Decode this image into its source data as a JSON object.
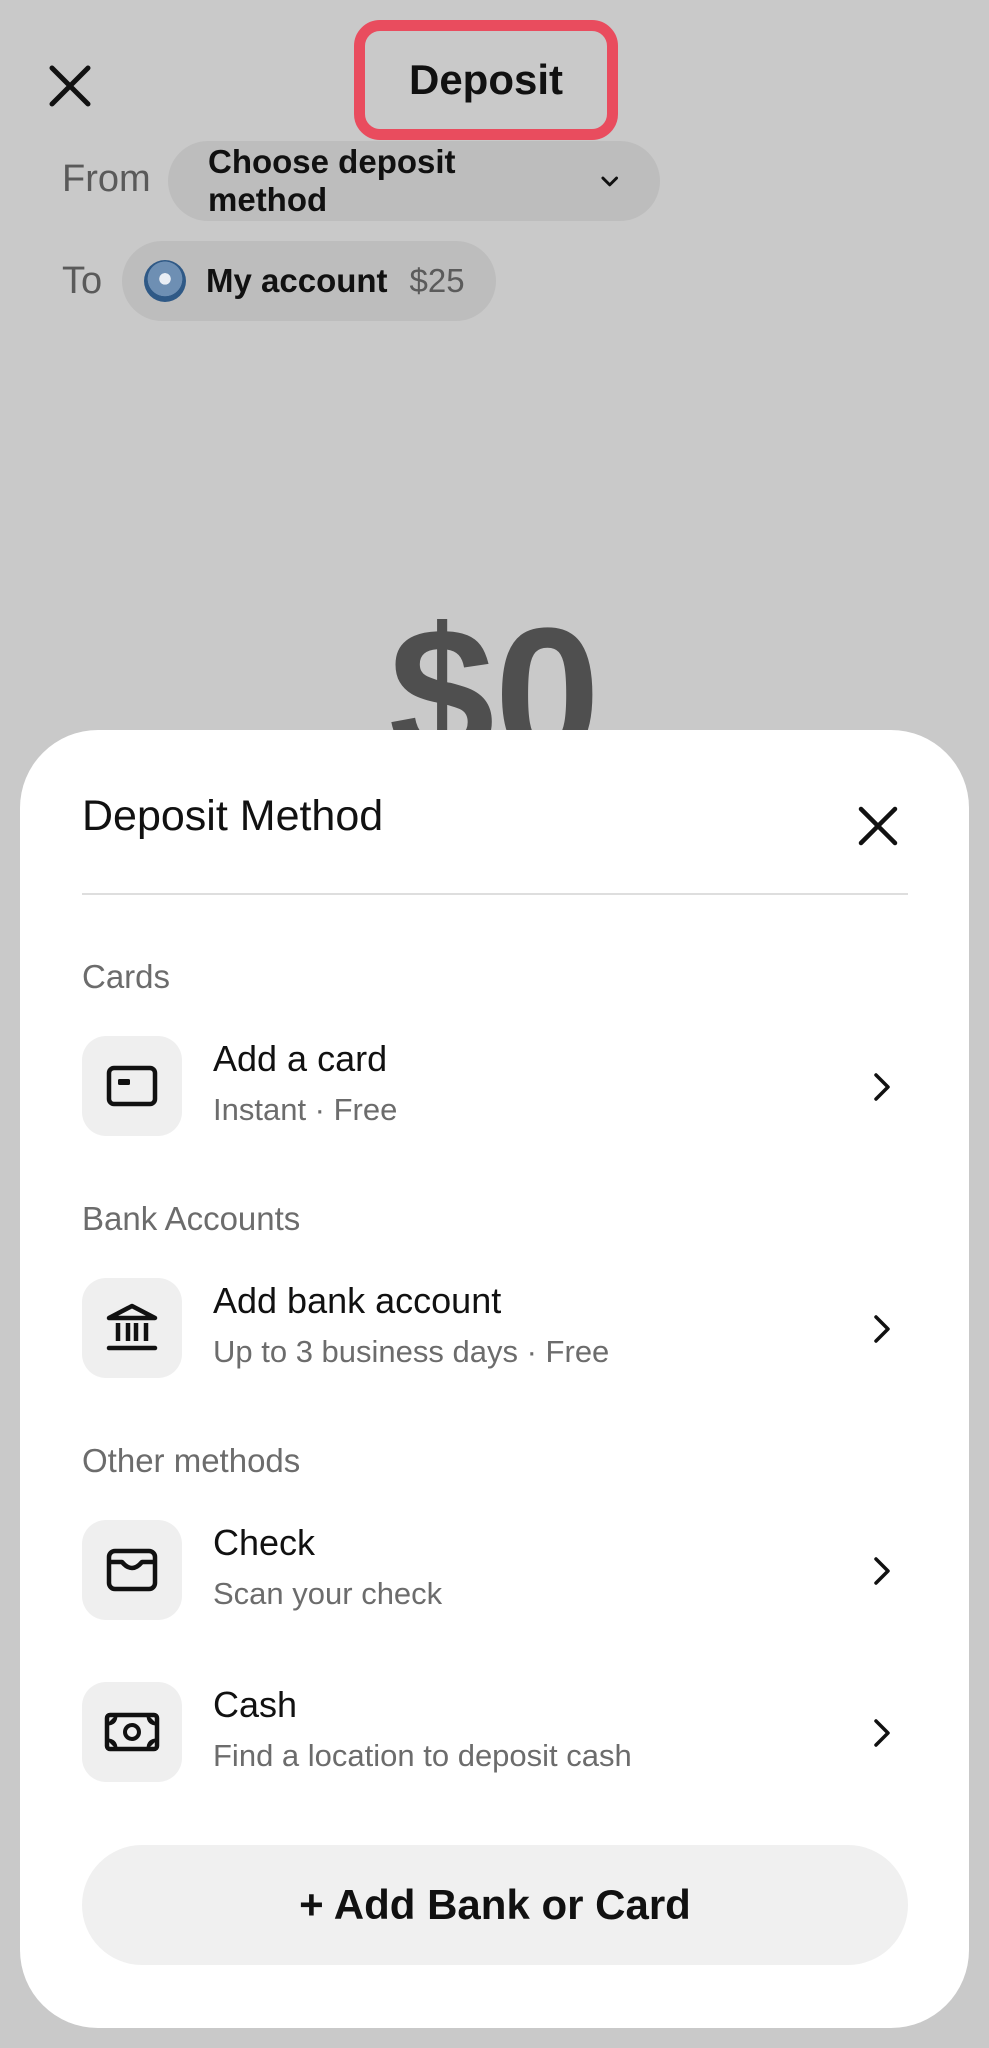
{
  "header": {
    "title": "Deposit",
    "highlight_color": "#e94c5e"
  },
  "from_row": {
    "label": "From",
    "value": "Choose deposit method"
  },
  "to_row": {
    "label": "To",
    "account_name": "My account",
    "balance": "$25"
  },
  "amount": "$0",
  "sheet": {
    "title": "Deposit Method",
    "sections": [
      {
        "label": "Cards",
        "items": [
          {
            "title": "Add a card",
            "subtitle": "Instant · Free",
            "icon": "card-icon"
          }
        ]
      },
      {
        "label": "Bank Accounts",
        "items": [
          {
            "title": "Add bank account",
            "subtitle": "Up to 3 business days · Free",
            "icon": "bank-icon"
          }
        ]
      },
      {
        "label": "Other methods",
        "items": [
          {
            "title": "Check",
            "subtitle": "Scan your check",
            "icon": "check-icon"
          },
          {
            "title": "Cash",
            "subtitle": "Find a location to deposit cash",
            "icon": "cash-icon"
          }
        ]
      }
    ],
    "add_button_label": "+ Add Bank or Card"
  }
}
